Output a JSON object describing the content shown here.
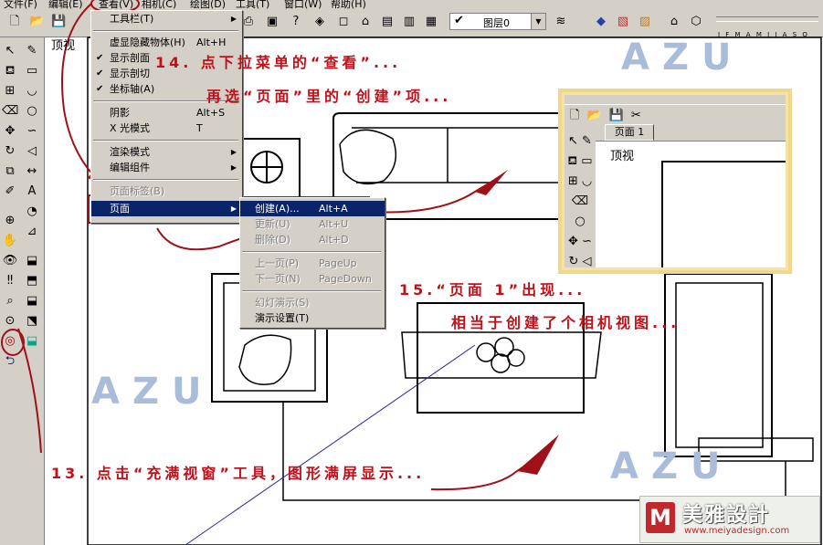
{
  "menubar": {
    "items": [
      "文件(F)",
      "编辑(E)",
      "查看(V)",
      "相机(C)",
      "绘图(D)",
      "工具(T)",
      "窗口(W)",
      "帮助(H)"
    ]
  },
  "toolbar": {
    "layer_value": "图层0",
    "months": "J F M A M J J A S O N D"
  },
  "view_label": "顶视",
  "view_menu": {
    "items": [
      {
        "label": "工具栏(T)",
        "shortcut": "",
        "check": false,
        "submenu": true,
        "disabled": false
      },
      {
        "label": "虚显隐藏物体(H)",
        "shortcut": "Alt+H",
        "check": false,
        "submenu": false,
        "disabled": false
      },
      {
        "label": "显示剖面",
        "shortcut": "",
        "check": true,
        "submenu": false,
        "disabled": false
      },
      {
        "label": "显示剖切",
        "shortcut": "",
        "check": true,
        "submenu": false,
        "disabled": false
      },
      {
        "label": "坐标轴(A)",
        "shortcut": "",
        "check": true,
        "submenu": false,
        "disabled": false
      },
      {
        "label": "阴影",
        "shortcut": "Alt+S",
        "check": false,
        "submenu": false,
        "disabled": false
      },
      {
        "label": "X 光模式",
        "shortcut": "T",
        "check": false,
        "submenu": false,
        "disabled": false
      },
      {
        "label": "渲染模式",
        "shortcut": "",
        "check": false,
        "submenu": true,
        "disabled": false
      },
      {
        "label": "编辑组件",
        "shortcut": "",
        "check": false,
        "submenu": true,
        "disabled": false
      },
      {
        "label": "页面标签(B)",
        "shortcut": "",
        "check": false,
        "submenu": false,
        "disabled": true
      },
      {
        "label": "页面",
        "shortcut": "",
        "check": false,
        "submenu": true,
        "disabled": false,
        "highlighted": true
      }
    ]
  },
  "page_submenu": {
    "items": [
      {
        "label": "创建(A)...",
        "shortcut": "Alt+A",
        "disabled": false,
        "highlighted": true
      },
      {
        "label": "更新(U)",
        "shortcut": "Alt+U",
        "disabled": true
      },
      {
        "label": "删除(D)",
        "shortcut": "Alt+D",
        "disabled": true
      },
      {
        "label": "上一页(P)",
        "shortcut": "PageUp",
        "disabled": true
      },
      {
        "label": "下一页(N)",
        "shortcut": "PageDown",
        "disabled": true
      },
      {
        "label": "幻灯演示(S)",
        "shortcut": "",
        "disabled": true
      },
      {
        "label": "演示设置(T)",
        "shortcut": "",
        "disabled": false
      }
    ]
  },
  "annotations": {
    "step14_a": "14. 点下拉菜单的“查看”...",
    "step14_b": "再选“页面”里的“创建”项...",
    "step15_a": "15.“页面 1”出现...",
    "step15_b": "相当于创建了个相机视图...",
    "step13": "13. 点击“充满视窗”工具，图形满屏显示..."
  },
  "watermark": "AZU",
  "inset": {
    "tab_label": "页面 1",
    "view_label": "顶视"
  },
  "logo": {
    "name": "美雅設計",
    "url": "www.meiyadesign.com"
  },
  "colors": {
    "annotation": "#c0101a",
    "highlight": "#0a246a",
    "watermark": "#a9bcd9",
    "inset_border": "#f0d88a"
  }
}
